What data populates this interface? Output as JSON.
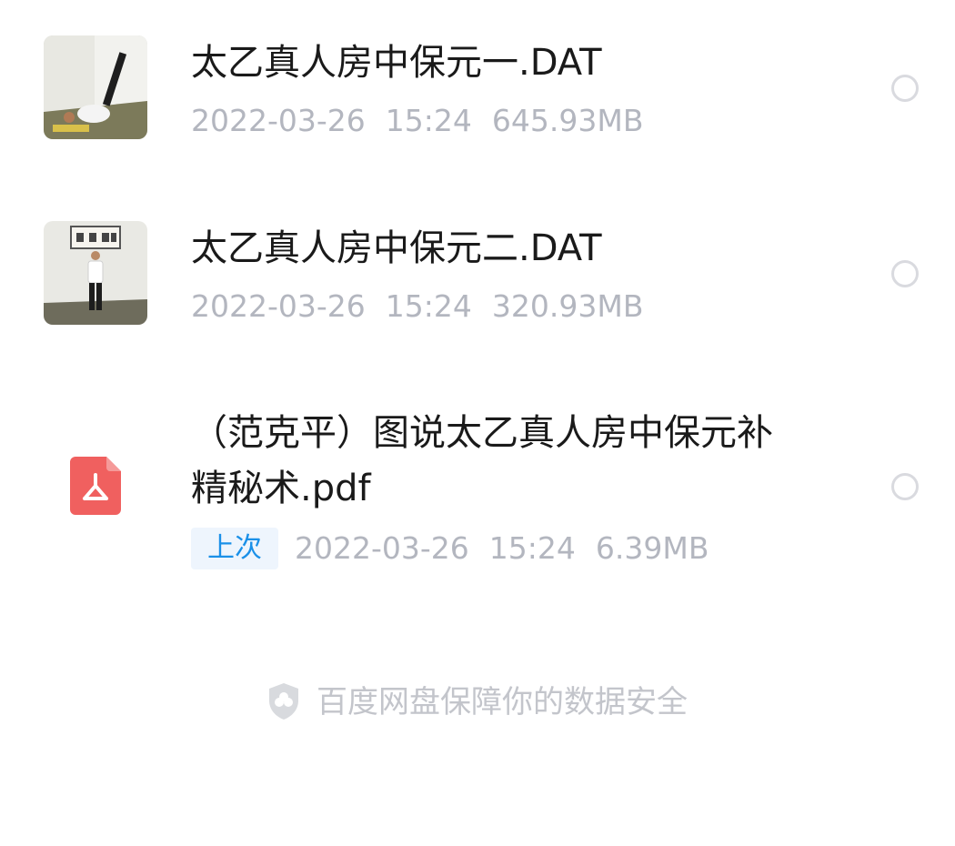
{
  "files": [
    {
      "name": "太乙真人房中保元一.DAT",
      "date": "2022-03-26",
      "time": "15:24",
      "size": "645.93MB",
      "icon": "video-thumbnail"
    },
    {
      "name": "太乙真人房中保元二.DAT",
      "date": "2022-03-26",
      "time": "15:24",
      "size": "320.93MB",
      "icon": "video-thumbnail"
    },
    {
      "name_line1": "（范克平）图说太乙真人房中保元补",
      "name_line2": "精秘术.pdf",
      "badge": "上次",
      "date": "2022-03-26",
      "time": "15:24",
      "size": "6.39MB",
      "icon": "pdf-icon"
    }
  ],
  "footer": {
    "text": "百度网盘保障你的数据安全",
    "icon": "shield-icon"
  },
  "colors": {
    "name_text": "#1a1a1a",
    "meta_text": "#b3b6bf",
    "badge_text": "#1a90e8",
    "badge_bg": "#eef5fd",
    "pdf_red": "#f0605f"
  }
}
